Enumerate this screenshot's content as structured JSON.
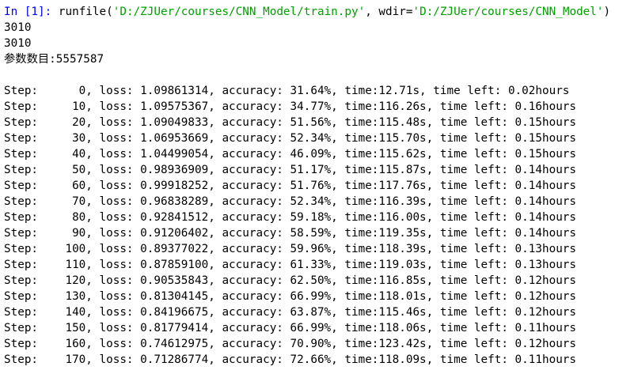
{
  "prompt": {
    "in_label": "In [1]:",
    "call_prefix": " runfile(",
    "file_arg": "'D:/ZJUer/courses/CNN_Model/train.py'",
    "mid": ", wdir=",
    "wdir_arg": "'D:/ZJUer/courses/CNN_Model'",
    "call_suffix": ")"
  },
  "output_lines": [
    "3010",
    "3010",
    "参数数目:5557587"
  ],
  "steps": [
    "Step:      0, loss: 1.09861314, accuracy: 31.64%, time:12.71s, time left: 0.02hours",
    "Step:     10, loss: 1.09575367, accuracy: 34.77%, time:116.26s, time left: 0.16hours",
    "Step:     20, loss: 1.09049833, accuracy: 51.56%, time:115.48s, time left: 0.15hours",
    "Step:     30, loss: 1.06953669, accuracy: 52.34%, time:115.70s, time left: 0.15hours",
    "Step:     40, loss: 1.04499054, accuracy: 46.09%, time:115.62s, time left: 0.15hours",
    "Step:     50, loss: 0.98936909, accuracy: 51.17%, time:115.87s, time left: 0.14hours",
    "Step:     60, loss: 0.99918252, accuracy: 51.76%, time:117.76s, time left: 0.14hours",
    "Step:     70, loss: 0.96838289, accuracy: 52.34%, time:116.39s, time left: 0.14hours",
    "Step:     80, loss: 0.92841512, accuracy: 59.18%, time:116.00s, time left: 0.14hours",
    "Step:     90, loss: 0.91206402, accuracy: 58.59%, time:119.35s, time left: 0.14hours",
    "Step:    100, loss: 0.89377022, accuracy: 59.96%, time:118.39s, time left: 0.13hours",
    "Step:    110, loss: 0.87859100, accuracy: 61.33%, time:119.03s, time left: 0.13hours",
    "Step:    120, loss: 0.90535843, accuracy: 62.50%, time:116.85s, time left: 0.12hours",
    "Step:    130, loss: 0.81304145, accuracy: 66.99%, time:118.01s, time left: 0.12hours",
    "Step:    140, loss: 0.84196675, accuracy: 63.87%, time:115.46s, time left: 0.12hours",
    "Step:    150, loss: 0.81779414, accuracy: 66.99%, time:118.06s, time left: 0.11hours",
    "Step:    160, loss: 0.74612975, accuracy: 70.90%, time:123.42s, time left: 0.12hours",
    "Step:    170, loss: 0.71286774, accuracy: 72.66%, time:118.09s, time left: 0.11hours"
  ],
  "colors": {
    "prompt": "#0000ff",
    "string": "#00a000",
    "text": "#000000",
    "background": "#ffffff"
  }
}
